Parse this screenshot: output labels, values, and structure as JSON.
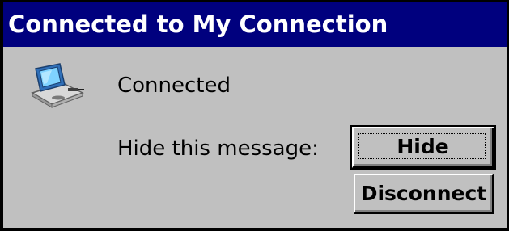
{
  "window": {
    "title": "Connected to My Connection"
  },
  "status": {
    "icon": "network-connection-icon",
    "text": "Connected"
  },
  "hide_prompt": {
    "text": "Hide this message:"
  },
  "buttons": {
    "hide_label": "Hide",
    "disconnect_label": "Disconnect"
  },
  "colors": {
    "titlebar": "#00007e",
    "window_bg": "#c0c0c0",
    "title_text": "#ffffff"
  }
}
